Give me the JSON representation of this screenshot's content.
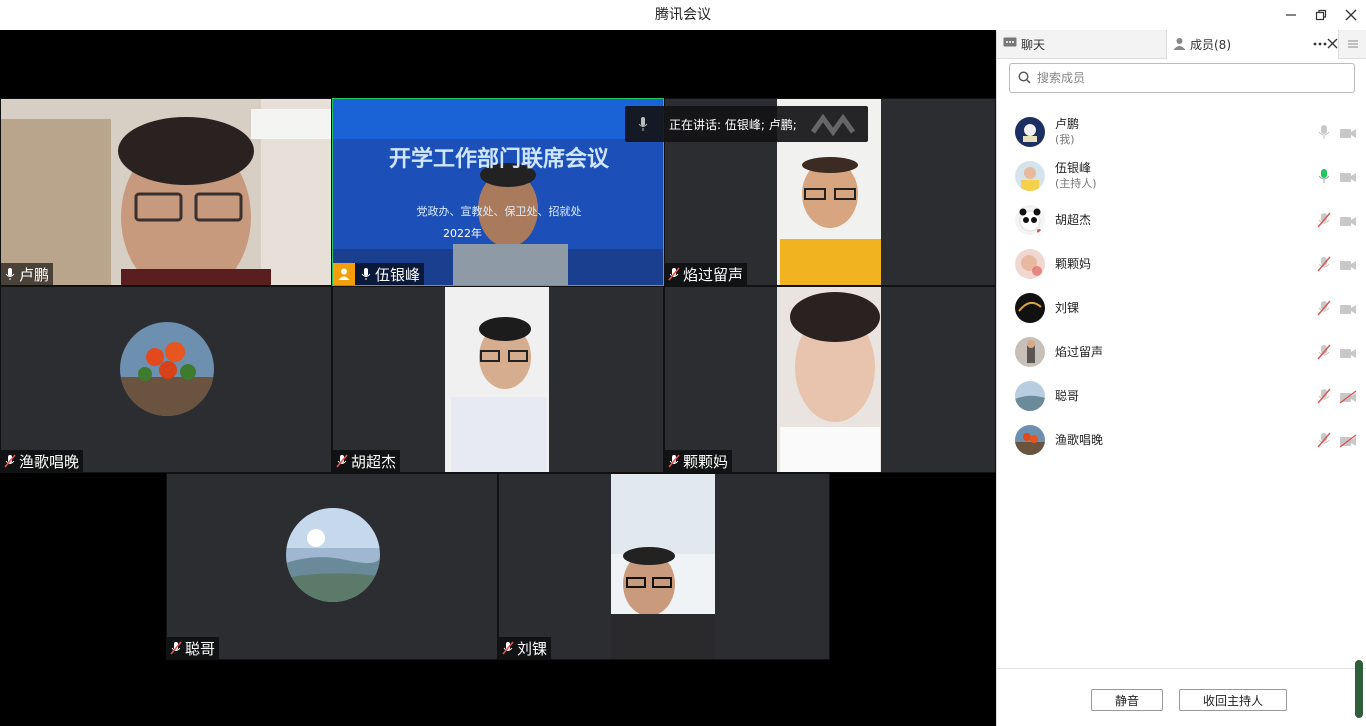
{
  "window": {
    "title": "腾讯会议"
  },
  "speaking": {
    "text": "正在讲话: 伍银峰; 卢鹏;"
  },
  "tiles": [
    {
      "name": "卢鹏"
    },
    {
      "name": "伍银峰",
      "slide_title": "开学工作部门联席会议",
      "slide_sub": "党政办、宣教处、保卫处、招就处",
      "slide_date": "2022年"
    },
    {
      "name": "焰过留声"
    },
    {
      "name": "渔歌唱晚"
    },
    {
      "name": "胡超杰"
    },
    {
      "name": "颗颗妈"
    },
    {
      "name": "聪哥"
    },
    {
      "name": "刘锞"
    }
  ],
  "panel": {
    "tab_chat": "聊天",
    "tab_members": "成员(8)",
    "search_placeholder": "搜索成员",
    "members": [
      {
        "name": "卢鹏",
        "sub": "(我)",
        "mic": "on-idle",
        "cam": "on"
      },
      {
        "name": "伍银峰",
        "sub": "(主持人)",
        "mic": "speaking",
        "cam": "on"
      },
      {
        "name": "胡超杰",
        "sub": "",
        "mic": "muted",
        "cam": "on"
      },
      {
        "name": "颗颗妈",
        "sub": "",
        "mic": "muted",
        "cam": "on"
      },
      {
        "name": "刘锞",
        "sub": "",
        "mic": "muted",
        "cam": "on"
      },
      {
        "name": "焰过留声",
        "sub": "",
        "mic": "muted",
        "cam": "on"
      },
      {
        "name": "聪哥",
        "sub": "",
        "mic": "muted",
        "cam": "off"
      },
      {
        "name": "渔歌唱晚",
        "sub": "",
        "mic": "muted",
        "cam": "off"
      }
    ],
    "btn_mute": "静音",
    "btn_reclaim_host": "收回主持人"
  },
  "colors": {
    "active_border": "#22c55e",
    "muted_red": "#e05252",
    "speaking_green": "#22c55e",
    "host_badge": "#f59e0b"
  }
}
